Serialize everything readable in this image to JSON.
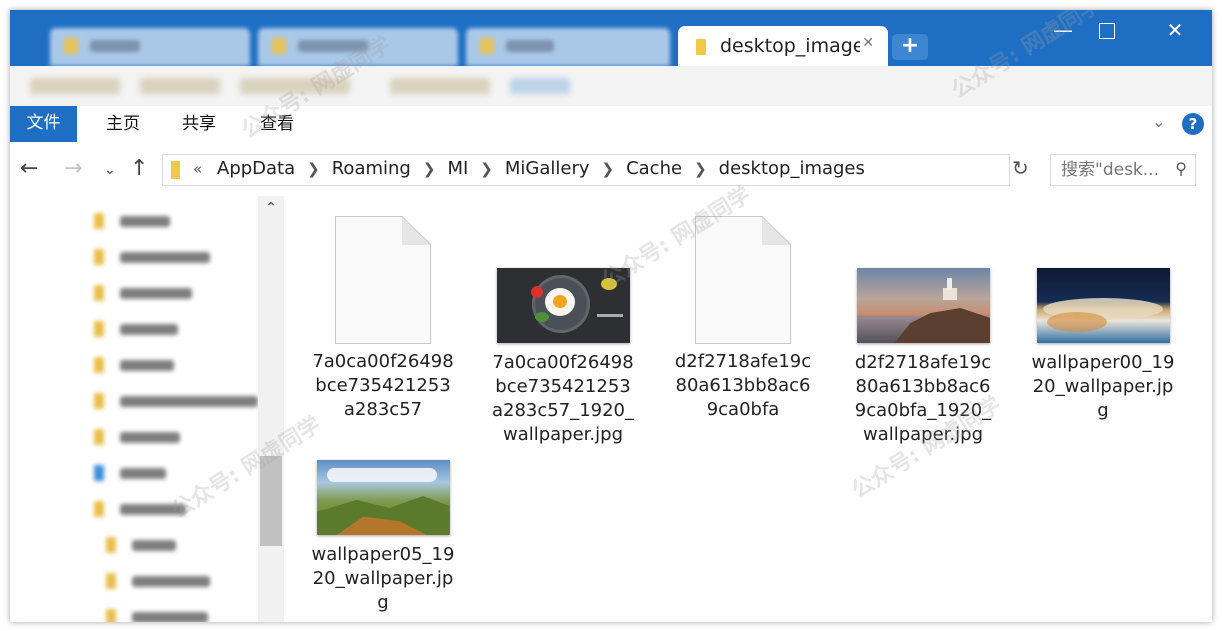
{
  "tabs": {
    "active_label": "desktop_images",
    "new_tab_label": "+"
  },
  "window": {
    "minimize": "—",
    "close": "✕"
  },
  "ribbon": {
    "items": [
      "文件",
      "主页",
      "共享",
      "查看"
    ],
    "help_label": "?"
  },
  "address": {
    "overflow": "«",
    "crumbs": [
      "AppData",
      "Roaming",
      "MI",
      "MiGallery",
      "Cache",
      "desktop_images"
    ]
  },
  "search": {
    "placeholder": "搜索\"desk..."
  },
  "files": [
    {
      "name": "7a0ca00f26498bce735421253a283c57",
      "type": "document",
      "icon": "blank-file-icon"
    },
    {
      "name": "7a0ca00f26498bce735421253a283c57_1920_wallpaper.jpg",
      "type": "image",
      "icon": "food-thumbnail"
    },
    {
      "name": "d2f2718afe19c80a613bb8ac69ca0bfa",
      "type": "document",
      "icon": "blank-file-icon"
    },
    {
      "name": "d2f2718afe19c80a613bb8ac69ca0bfa_1920_wallpaper.jpg",
      "type": "image",
      "icon": "lighthouse-thumbnail"
    },
    {
      "name": "wallpaper00_1920_wallpaper.jpg",
      "type": "image",
      "icon": "aerial-thumbnail"
    },
    {
      "name": "wallpaper05_1920_wallpaper.jpg",
      "type": "image",
      "icon": "landscape-thumbnail"
    }
  ],
  "file_labels": [
    [
      "7a0ca00f26498",
      "bce735421253",
      "a283c57"
    ],
    [
      "7a0ca00f26498",
      "bce735421253",
      "a283c57_1920_",
      "wallpaper.jpg"
    ],
    [
      "d2f2718afe19c",
      "80a613bb8ac6",
      "9ca0bfa"
    ],
    [
      "d2f2718afe19c",
      "80a613bb8ac6",
      "9ca0bfa_1920_",
      "wallpaper.jpg"
    ],
    [
      "wallpaper00_19",
      "20_wallpaper.jp",
      "g"
    ],
    [
      "wallpaper05_19",
      "20_wallpaper.jp",
      "g"
    ]
  ],
  "watermark": "公众号: 网虚同学",
  "colors": {
    "accent": "#1e6fc4",
    "folder": "#f2c84a"
  }
}
